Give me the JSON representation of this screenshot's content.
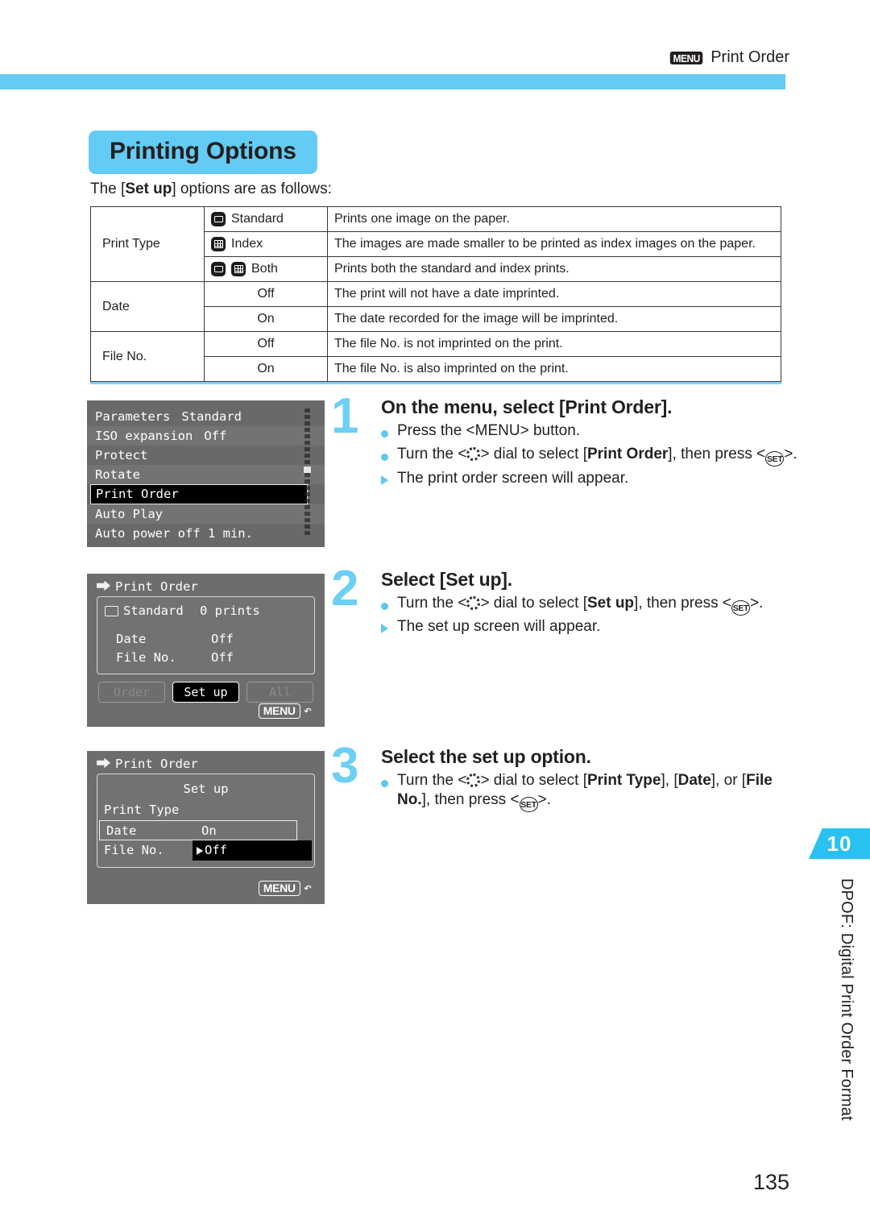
{
  "header": {
    "menu_badge": "MENU",
    "title": "Print Order"
  },
  "page_title": "Printing Options",
  "intro": {
    "prefix": "The [",
    "bold": "Set up",
    "suffix": "] options are as follows:"
  },
  "table": {
    "rows": [
      {
        "label": "Print Type",
        "options": [
          {
            "icons": [
              "standard-icon"
            ],
            "name": "Standard",
            "desc": "Prints one image on the paper."
          },
          {
            "icons": [
              "index-icon"
            ],
            "name": "Index",
            "desc": "The images are made smaller to be printed as index images on the paper."
          },
          {
            "icons": [
              "standard-icon",
              "index-icon"
            ],
            "name": "Both",
            "desc": "Prints both the standard and index prints."
          }
        ]
      },
      {
        "label": "Date",
        "options": [
          {
            "icons": [],
            "name": "Off",
            "desc": "The print will not have a date imprinted."
          },
          {
            "icons": [],
            "name": "On",
            "desc": "The date recorded for the image will be imprinted."
          }
        ]
      },
      {
        "label": "File No.",
        "options": [
          {
            "icons": [],
            "name": "Off",
            "desc": "The file No. is not imprinted on the print."
          },
          {
            "icons": [],
            "name": "On",
            "desc": "The file No. is also imprinted on the print."
          }
        ]
      }
    ]
  },
  "lcd1": {
    "items": [
      {
        "name": "Parameters",
        "value": "Standard",
        "selected": false
      },
      {
        "name": "ISO expansion",
        "value": "Off",
        "selected": false
      },
      {
        "name": "Protect",
        "value": "",
        "selected": false
      },
      {
        "name": "Rotate",
        "value": "",
        "selected": false
      },
      {
        "name": "Print Order",
        "value": "",
        "selected": true
      },
      {
        "name": "Auto Play",
        "value": "",
        "selected": false
      },
      {
        "name": "Auto power off 1 min.",
        "value": "",
        "selected": false
      }
    ]
  },
  "lcd2": {
    "title": "Print Order",
    "standard_label": "Standard",
    "standard_value": "0 prints",
    "date_label": "Date",
    "date_value": "Off",
    "fileno_label": "File No.",
    "fileno_value": "Off",
    "buttons": [
      {
        "label": "Order",
        "active": false
      },
      {
        "label": "Set up",
        "active": true
      },
      {
        "label": "All",
        "active": false
      }
    ],
    "menu_key": "MENU"
  },
  "lcd3": {
    "title": "Print Order",
    "setup_header": "Set up",
    "print_type_label": "Print Type",
    "date_label": "Date",
    "date_value": "On",
    "fileno_label": "File No.",
    "fileno_value": "Off",
    "menu_key": "MENU"
  },
  "steps": [
    {
      "number": "1",
      "title": "On the menu, select [Print Order].",
      "lines": [
        {
          "marker": "dot",
          "html": "Press the &lt;MENU&gt; button."
        },
        {
          "marker": "dot",
          "html": "Turn the &lt;<span class=\"dial\"></span>&gt; dial to select [<b>Print Order</b>], then press &lt;<span class=\"setk\">SET</span>&gt;."
        },
        {
          "marker": "arrow",
          "html": "The print order screen will appear."
        }
      ]
    },
    {
      "number": "2",
      "title": "Select [Set up].",
      "lines": [
        {
          "marker": "dot",
          "html": "Turn the &lt;<span class=\"dial\"></span>&gt; dial to select [<b>Set up</b>], then press &lt;<span class=\"setk\">SET</span>&gt;."
        },
        {
          "marker": "arrow",
          "html": "The set up screen will appear."
        }
      ]
    },
    {
      "number": "3",
      "title": "Select the set up option.",
      "lines": [
        {
          "marker": "dot",
          "html": "Turn the &lt;<span class=\"dial\"></span>&gt; dial to select [<b>Print Type</b>], [<b>Date</b>], or [<b>File No.</b>], then press &lt;<span class=\"setk\">SET</span>&gt;."
        }
      ]
    }
  ],
  "sidebar": {
    "chapter_number": "10",
    "chapter_title": "DPOF: Digital Print Order Format"
  },
  "page_number": "135",
  "colors": {
    "accent_blue": "#63cbf4",
    "tab_blue": "#29c1f0",
    "bullet_blue": "#5fc8ef",
    "ink": "#231f20"
  }
}
